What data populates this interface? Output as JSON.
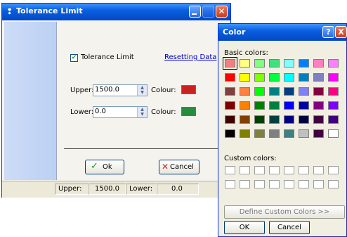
{
  "tolerance_window": {
    "title": "Tolerance Limit",
    "enable_checkbox_label": "Tolerance Limit",
    "enable_checked": true,
    "reset_link": "Resetting Data",
    "upper": {
      "label": "Upper:",
      "value": "1500.0",
      "colour_label": "Colour:",
      "colour": "#c82323"
    },
    "lower": {
      "label": "Lower:",
      "value": "0.0",
      "colour_label": "Colour:",
      "colour": "#2a8a3e"
    },
    "ok_button": "Ok",
    "cancel_button": "Cancel",
    "status": {
      "upper_label": "Upper:",
      "upper_value": "1500.0",
      "lower_label": "Lower:",
      "lower_value": "0.0"
    }
  },
  "color_dialog": {
    "title": "Color",
    "help_glyph": "?",
    "close_glyph": "X",
    "basic_colors_label": "Basic colors:",
    "basic_colors": [
      [
        "#f08080",
        "#ffff80",
        "#80ff80",
        "#40e080",
        "#80ffff",
        "#0080ff",
        "#ff80c0",
        "#ff80ff"
      ],
      [
        "#ff0000",
        "#ffff00",
        "#80ff00",
        "#00ff40",
        "#00ffff",
        "#0080c0",
        "#8080c0",
        "#ff00ff"
      ],
      [
        "#804040",
        "#ff8040",
        "#00ff00",
        "#008080",
        "#004080",
        "#8080ff",
        "#800040",
        "#ff0080"
      ],
      [
        "#800000",
        "#ff8000",
        "#008000",
        "#008040",
        "#0000ff",
        "#0000a0",
        "#800080",
        "#8000ff"
      ],
      [
        "#400000",
        "#804000",
        "#004000",
        "#004040",
        "#000080",
        "#000040",
        "#400040",
        "#400080"
      ],
      [
        "#000000",
        "#808000",
        "#808040",
        "#808080",
        "#408080",
        "#c0c0c0",
        "#400040",
        "#ffffff"
      ]
    ],
    "selected_color": "#f08080",
    "custom_colors_label": "Custom colors:",
    "define_button": "Define Custom Colors >>",
    "ok_button": "OK",
    "cancel_button": "Cancel"
  }
}
